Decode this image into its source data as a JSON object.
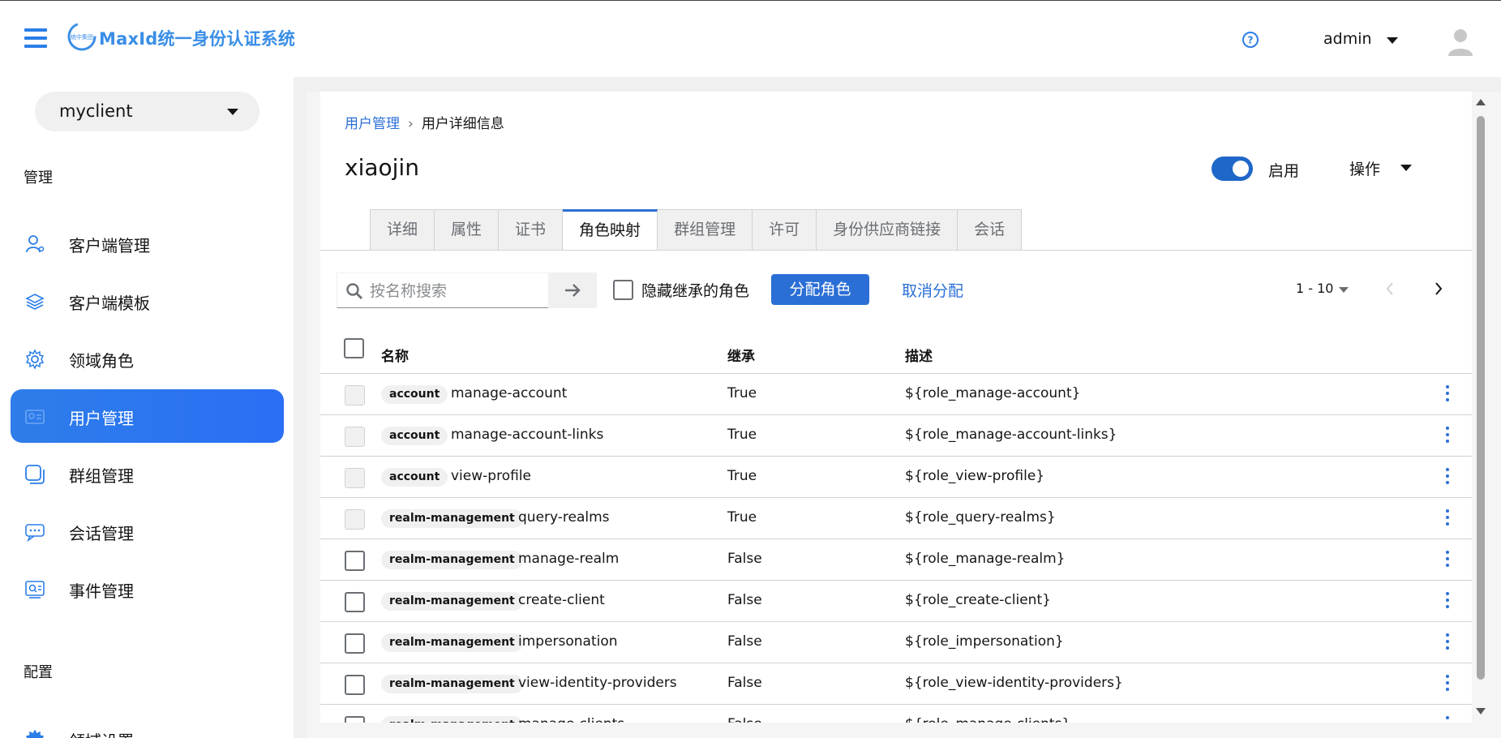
{
  "header": {
    "brand": "MaxId统一身份认证系统",
    "logo_text": "统中集团",
    "username": "admin",
    "colors": {
      "brand": "#3a8ee6",
      "accent": "#2b6fd6",
      "active_nav": "#2e7de9"
    }
  },
  "sidebar": {
    "client_select": "myclient",
    "section_manage": "管理",
    "items": [
      {
        "label": "客户端管理",
        "icon": "user-outline-icon"
      },
      {
        "label": "客户端模板",
        "icon": "layers-icon"
      },
      {
        "label": "领域角色",
        "icon": "gear-icon"
      },
      {
        "label": "用户管理",
        "icon": "id-card-icon",
        "active": true
      },
      {
        "label": "群组管理",
        "icon": "group-square-icon"
      },
      {
        "label": "会话管理",
        "icon": "chat-icon"
      },
      {
        "label": "事件管理",
        "icon": "event-log-icon"
      }
    ],
    "section_config": "配置",
    "partial_item": "领域设置"
  },
  "breadcrumb": {
    "parent": "用户管理",
    "current": "用户详细信息"
  },
  "page": {
    "title": "xiaojin",
    "toggle_label": "启用",
    "toggle_on": true,
    "actions_label": "操作"
  },
  "tabs": [
    "详细",
    "属性",
    "证书",
    "角色映射",
    "群组管理",
    "许可",
    "身份供应商链接",
    "会话"
  ],
  "active_tab": "角色映射",
  "toolbar": {
    "search_placeholder": "按名称搜索",
    "hide_inherited_label": "隐藏继承的角色",
    "assign_label": "分配角色",
    "unassign_label": "取消分配",
    "pagination": "1 - 10"
  },
  "table": {
    "columns": [
      "名称",
      "继承",
      "描述"
    ],
    "rows": [
      {
        "badge": "account",
        "name": "manage-account",
        "inherited": "True",
        "description": "${role_manage-account}"
      },
      {
        "badge": "account",
        "name": "manage-account-links",
        "inherited": "True",
        "description": "${role_manage-account-links}"
      },
      {
        "badge": "account",
        "name": "view-profile",
        "inherited": "True",
        "description": "${role_view-profile}"
      },
      {
        "badge": "realm-management",
        "name": "query-realms",
        "inherited": "True",
        "description": "${role_query-realms}"
      },
      {
        "badge": "realm-management",
        "name": "manage-realm",
        "inherited": "False",
        "description": "${role_manage-realm}"
      },
      {
        "badge": "realm-management",
        "name": "create-client",
        "inherited": "False",
        "description": "${role_create-client}"
      },
      {
        "badge": "realm-management",
        "name": "impersonation",
        "inherited": "False",
        "description": "${role_impersonation}"
      },
      {
        "badge": "realm-management",
        "name": "view-identity-providers",
        "inherited": "False",
        "description": "${role_view-identity-providers}"
      },
      {
        "badge": "realm-management",
        "name": "manage-clients",
        "inherited": "False",
        "description": "${role_manage-clients}"
      }
    ]
  }
}
